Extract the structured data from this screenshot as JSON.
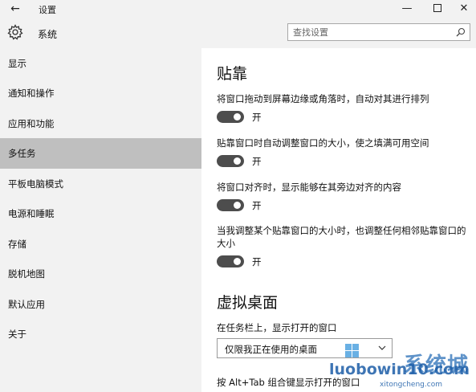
{
  "window": {
    "title": "设置",
    "back_icon": "back-arrow-icon",
    "minimize_glyph": "—",
    "close_glyph": "✕"
  },
  "header": {
    "title": "系统",
    "icon": "gear-icon",
    "search": {
      "placeholder": "查找设置",
      "icon": "search-icon"
    }
  },
  "sidebar": {
    "selected_index": 3,
    "items": [
      {
        "label": "显示"
      },
      {
        "label": "通知和操作"
      },
      {
        "label": "应用和功能"
      },
      {
        "label": "多任务"
      },
      {
        "label": "平板电脑模式"
      },
      {
        "label": "电源和睡眠"
      },
      {
        "label": "存储"
      },
      {
        "label": "脱机地图"
      },
      {
        "label": "默认应用"
      },
      {
        "label": "关于"
      }
    ]
  },
  "main": {
    "snap": {
      "title": "贴靠",
      "settings": [
        {
          "label": "将窗口拖动到屏幕边缘或角落时，自动对其进行排列",
          "state": "开"
        },
        {
          "label": "贴靠窗口时自动调整窗口的大小，使之填满可用空间",
          "state": "开"
        },
        {
          "label": "将窗口对齐时，显示能够在其旁边对齐的内容",
          "state": "开"
        },
        {
          "label": "当我调整某个贴靠窗口的大小时，也调整任何相邻贴靠窗口的大小",
          "state": "开"
        }
      ]
    },
    "virtual_desktops": {
      "title": "虚拟桌面",
      "taskbar_label": "在任务栏上，显示打开的窗口",
      "taskbar_value": "仅限我正在使用的桌面",
      "alt_tab_label": "按 Alt+Tab 组合键显示打开的窗口"
    }
  },
  "watermark": {
    "cn": "系统城",
    "main": "luobowin10.com",
    "sub": "xitongcheng.com"
  },
  "colors": {
    "sidebar_bg": "#f2f2f2",
    "selected_bg": "#bfbfbf",
    "toggle_on": "#4d4d4d"
  }
}
